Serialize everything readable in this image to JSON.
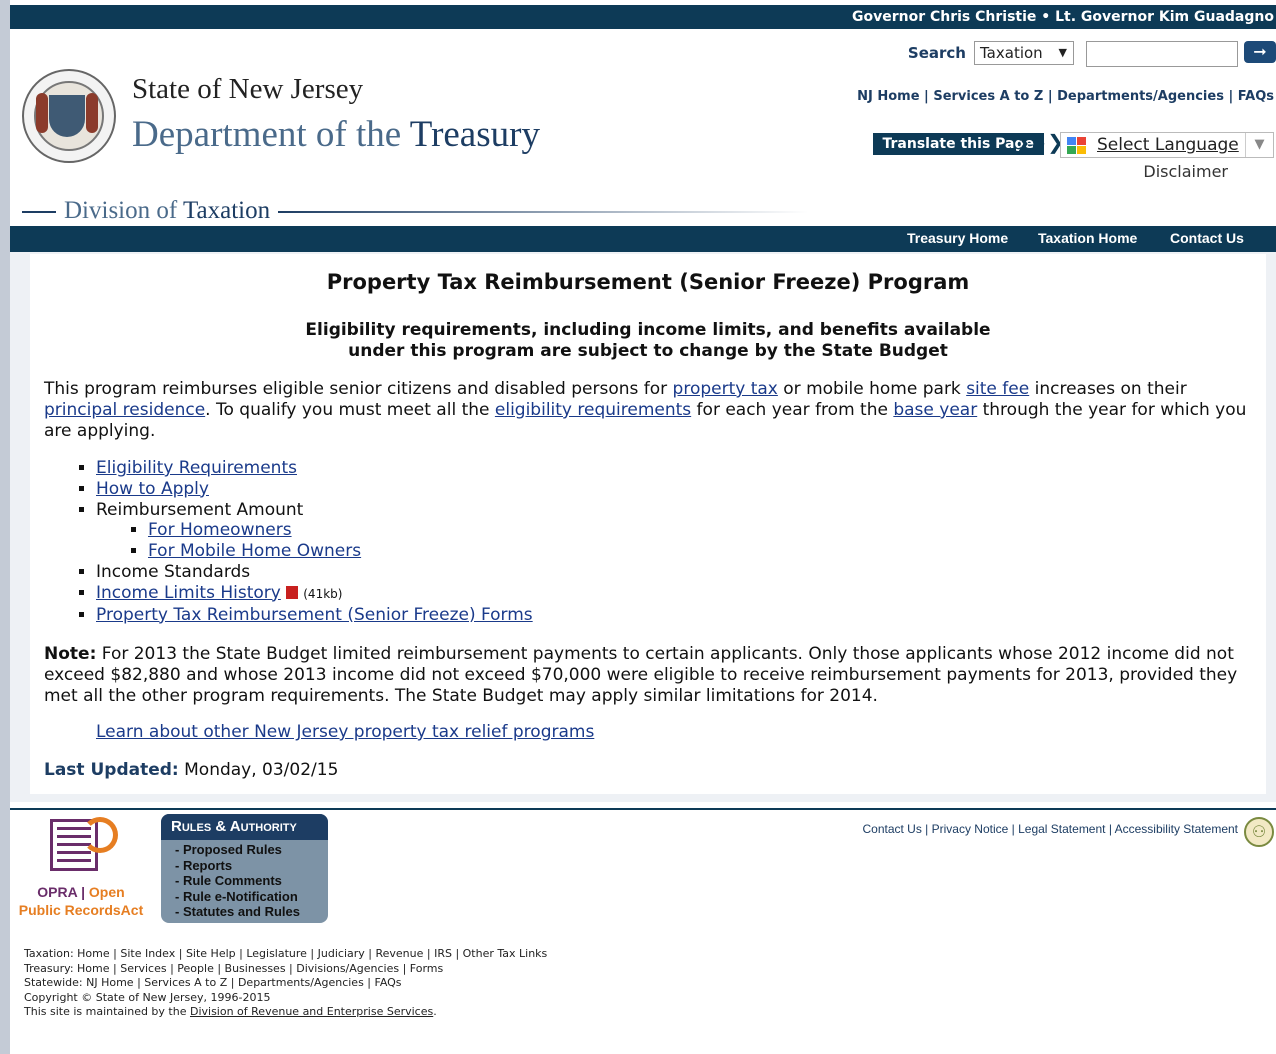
{
  "gov_bar": "Governor Chris Christie • Lt. Governor Kim Guadagno",
  "header": {
    "state": "State of New Jersey",
    "dept_prefix": "Department of the",
    "dept_bold": "Treasury",
    "division_prefix": "Division of",
    "division_bold": "Taxation"
  },
  "search": {
    "label": "Search",
    "scope": "Taxation",
    "go_icon": "arrow-right-icon"
  },
  "top_links": [
    "NJ Home",
    "Services A to Z",
    "Departments/Agencies",
    "FAQs"
  ],
  "translate": {
    "button": "Translate this Page",
    "chevrons": "❯❯❯",
    "select": "Select Language",
    "disclaimer": "Disclaimer"
  },
  "nav": [
    "Treasury Home",
    "Taxation Home",
    "Contact Us"
  ],
  "main": {
    "title": "Property Tax Reimbursement (Senior Freeze) Program",
    "subtitle_1": "Eligibility requirements, including income limits, and benefits available",
    "subtitle_2": "under this program are subject to change by the State Budget",
    "intro": {
      "t1": "This program reimburses eligible senior citizens and disabled persons for ",
      "l1": "property tax",
      "t2": " or mobile home park ",
      "l2": "site fee",
      "t3": " increases on their ",
      "l3": "principal residence",
      "t4": ". To qualify you must meet all the ",
      "l4": "eligibility requirements",
      "t5": " for each year from the ",
      "l5": "base year",
      "t6": " through the year for which you are applying."
    },
    "list": {
      "eligibility": "Eligibility Requirements",
      "how_to_apply": "How to Apply",
      "reimbursement": "Reimbursement Amount",
      "homeowners": "For Homeowners",
      "mobile": "For Mobile Home Owners",
      "income_standards": "Income Standards",
      "income_history": "Income Limits History",
      "income_history_size": "(41kb)",
      "forms": "Property Tax Reimbursement (Senior Freeze) Forms "
    },
    "note_label": "Note:",
    "note_text": " For 2013 the State Budget limited reimbursement payments to certain applicants. Only those applicants whose 2012 income did not exceed $82,880 and whose 2013 income did not exceed $70,000 were eligible to receive reimbursement payments for 2013, provided they met all the other program requirements. The State Budget may apply similar limitations for 2014.",
    "learn_more": "Learn about other New Jersey property tax relief programs",
    "updated_label": "Last Updated:",
    "updated_value": " Monday, 03/02/15"
  },
  "footer": {
    "opra_1": "OPRA",
    "opra_sep": " | ",
    "opra_2": "Open",
    "opra_3": "Public RecordsAct",
    "rules_title": "Rules & Authority",
    "rules_items": [
      "- Proposed Rules",
      "- Reports",
      "- Rule Comments",
      "- Rule e-Notification",
      "- Statutes and Rules"
    ],
    "links": "Contact Us | Privacy Notice | Legal Statement | Accessibility Statement",
    "line1": "Taxation: Home | Site Index | Site Help | Legislature | Judiciary | Revenue | IRS | Other Tax Links",
    "line2": "Treasury: Home | Services | People | Businesses | Divisions/Agencies | Forms",
    "line3": "Statewide: NJ Home | Services A to Z | Departments/Agencies | FAQs",
    "line4": "Copyright © State of New Jersey, 1996-2015",
    "line5_prefix": "This site is maintained by the ",
    "line5_link": "Division of Revenue and Enterprise Services",
    "line5_suffix": "."
  },
  "colors": {
    "navy": "#0d3a56",
    "link": "#1a3a8a",
    "opra_orange": "#e67e22",
    "opra_purple": "#6a2d6a"
  }
}
